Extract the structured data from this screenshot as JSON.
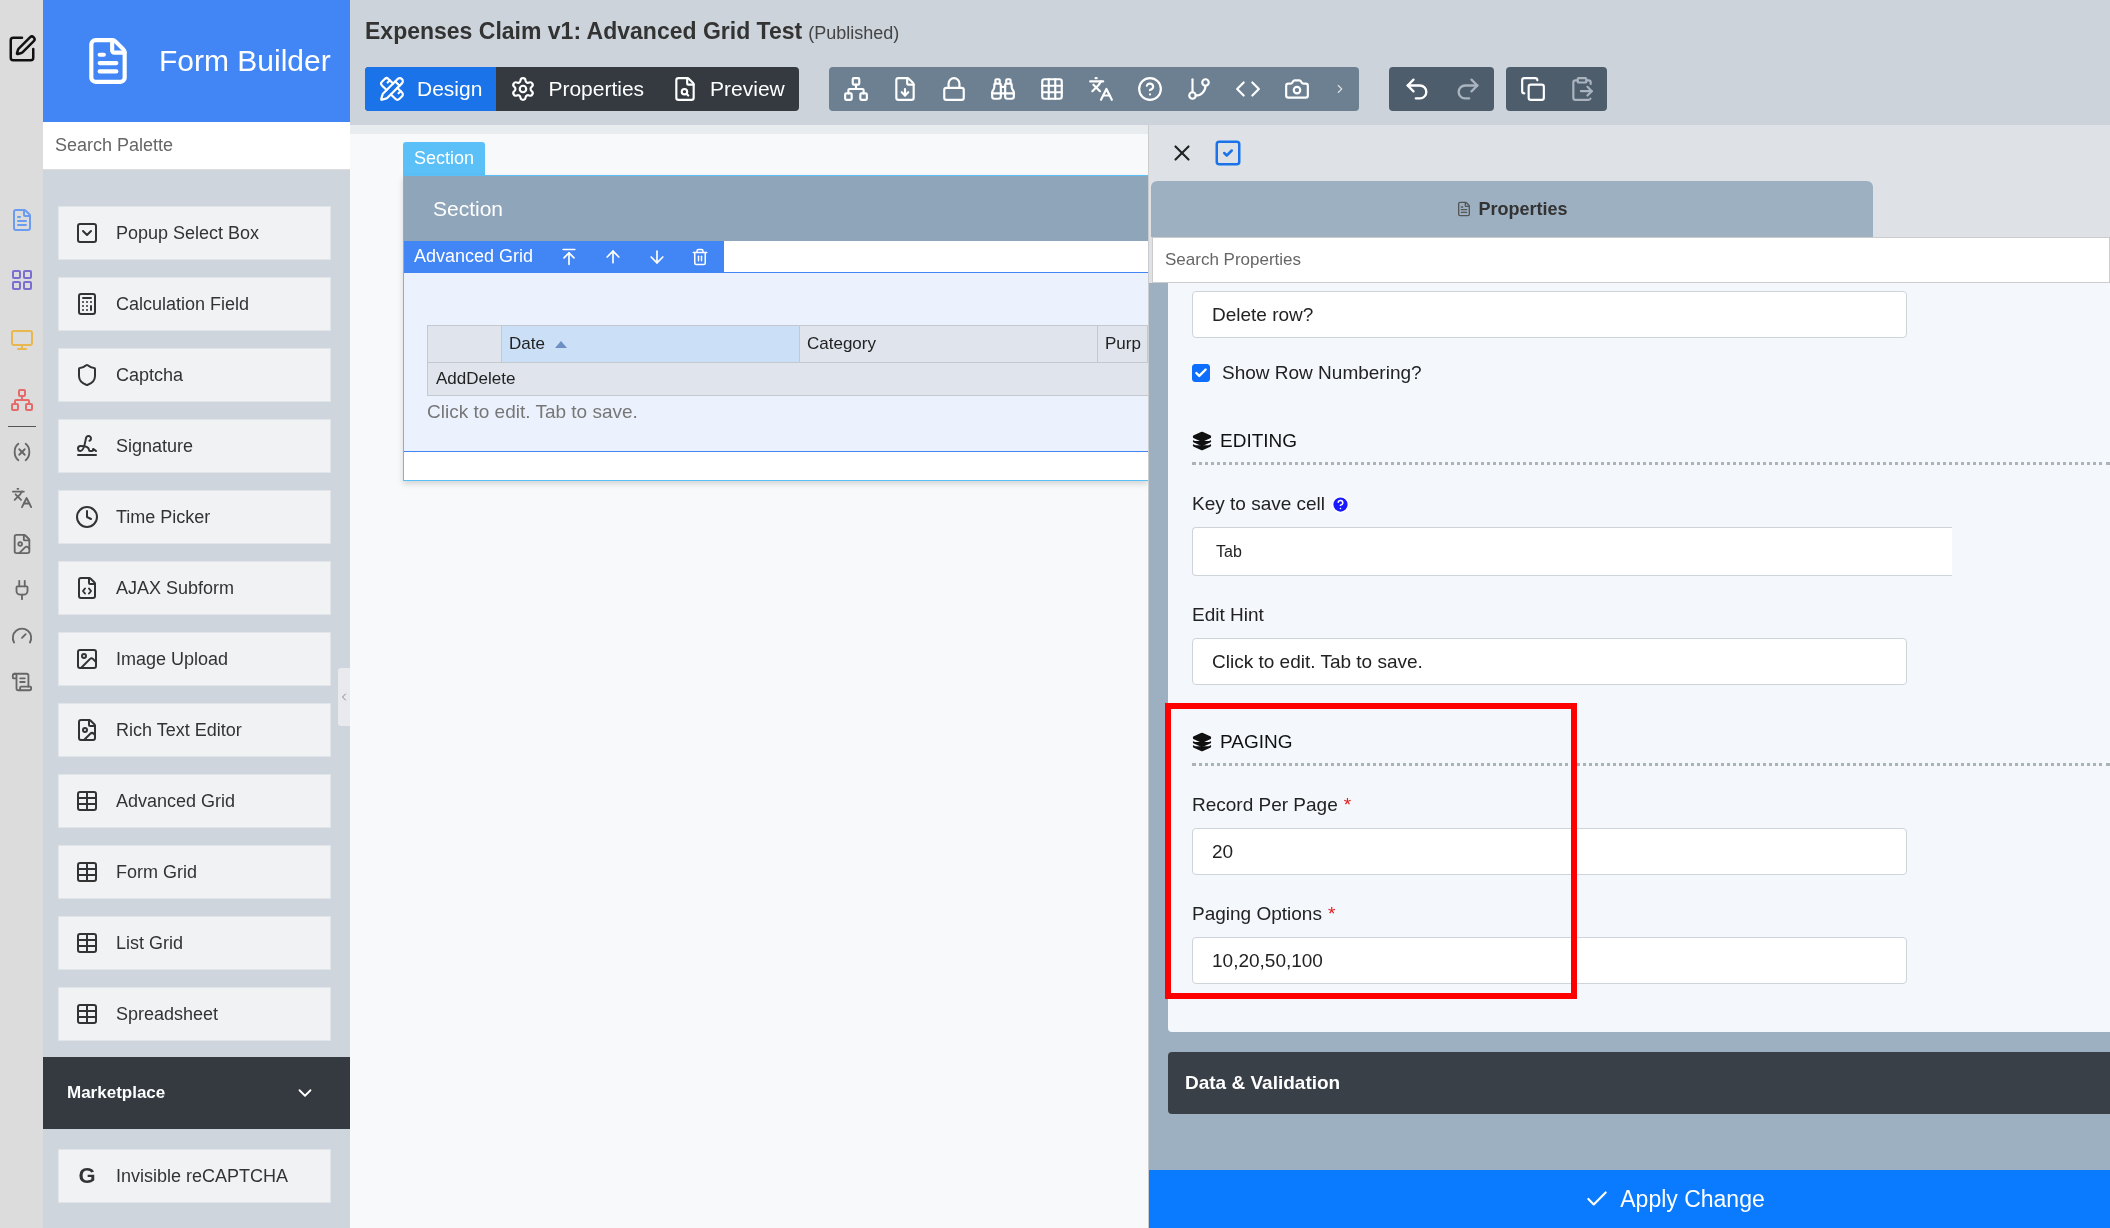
{
  "app": {
    "title": "Form Builder"
  },
  "palette": {
    "search_placeholder": "Search Palette",
    "items": [
      {
        "label": "Popup Select Box"
      },
      {
        "label": "Calculation Field"
      },
      {
        "label": "Captcha"
      },
      {
        "label": "Signature"
      },
      {
        "label": "Time Picker"
      },
      {
        "label": "AJAX Subform"
      },
      {
        "label": "Image Upload"
      },
      {
        "label": "Rich Text Editor"
      },
      {
        "label": "Advanced Grid"
      },
      {
        "label": "Form Grid"
      },
      {
        "label": "List Grid"
      },
      {
        "label": "Spreadsheet"
      }
    ]
  },
  "marketplace": {
    "title": "Marketplace",
    "expanded": true,
    "items": [
      {
        "label": "Invisible reCAPTCHA",
        "glyph": "G"
      }
    ]
  },
  "form": {
    "title": "Expenses Claim v1: Advanced Grid Test",
    "status": "(Published)"
  },
  "mode_tabs": [
    {
      "label": "Design",
      "selected": true
    },
    {
      "label": "Properties",
      "selected": false
    },
    {
      "label": "Preview",
      "selected": false
    }
  ],
  "canvas": {
    "section_tab": "Section",
    "section_title": "Section",
    "control_label": "Advanced Grid",
    "grid": {
      "columns": [
        {
          "sorted": false
        },
        {
          "label": "Date",
          "sorted": true
        },
        {
          "label": "Category",
          "sorted": false
        },
        {
          "label": "Purp",
          "sorted": false
        }
      ],
      "rows": [
        [
          "AddDelete"
        ]
      ],
      "hint": "Click to edit. Tab to save."
    }
  },
  "properties": {
    "tab": "Properties",
    "search_placeholder": "Search Properties",
    "top_value": "Delete row?",
    "show_row_numbering": {
      "label": "Show Row Numbering?",
      "checked": true
    },
    "sections": [
      {
        "title": "EDITING",
        "highlighted": false,
        "fields": [
          {
            "kind": "select",
            "label": "Key to save cell",
            "help": true,
            "value": "Tab"
          },
          {
            "kind": "text",
            "label": "Edit Hint",
            "help": false,
            "value": "Click to edit. Tab to save."
          }
        ]
      },
      {
        "title": "PAGING",
        "highlighted": true,
        "fields": [
          {
            "kind": "text",
            "label": "Record Per Page",
            "help": false,
            "required_mark": "*",
            "value": "20"
          },
          {
            "kind": "text",
            "label": "Paging Options",
            "help": false,
            "required_mark": "*",
            "value": "10,20,50,100"
          }
        ]
      }
    ],
    "collapsed_panel": "Data & Validation",
    "apply": "Apply Change"
  }
}
